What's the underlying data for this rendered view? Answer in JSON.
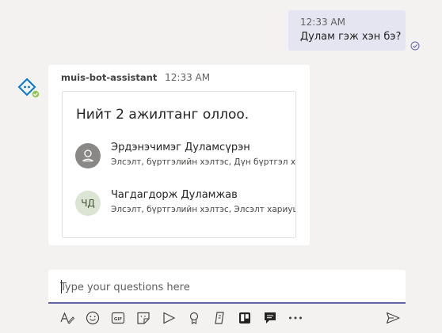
{
  "user_message": {
    "time": "12:33 AM",
    "text": "Дулам гэж хэн бэ?"
  },
  "bot_message": {
    "sender": "muis-bot-assistant",
    "time": "12:33 AM",
    "card": {
      "title": "Нийт 2 ажилтанг оллоо.",
      "people": [
        {
          "name": "Эрдэнэчимэг Дуламсүрэн",
          "description": "Элсэлт, бүртгэлийн хэлтэс, Дүн бүртгэл хариуцсан",
          "avatar": "person-icon"
        },
        {
          "name": "Чагдагдорж Дуламжав",
          "description": "Элсэлт, бүртгэлийн хэлтэс, Элсэлт хариуцсан",
          "initials": "ЧД"
        }
      ]
    }
  },
  "compose": {
    "placeholder": "Type your questions here",
    "value": ""
  },
  "toolbar": {
    "gif_label": "GIF",
    "more_label": "•••"
  },
  "colors": {
    "accent": "#6264a7",
    "user_bubble": "#e5e5f1",
    "bot_blue": "#0078d4",
    "status_green": "#92c353"
  }
}
